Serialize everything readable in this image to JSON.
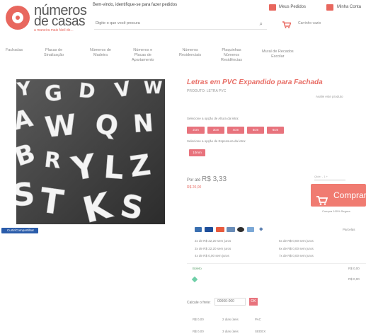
{
  "header": {
    "logo_line1": "números",
    "logo_line2": "de casas",
    "logo_tagline": "a maneira mais fácil de...",
    "welcome": "Bem-vindo, identifique-se para fazer pedidos",
    "search_placeholder": "Digite o que você procura",
    "my_orders": "Meus Pedidos",
    "my_account": "Minha Conta",
    "cart": "Carrinho vazio"
  },
  "nav": {
    "items": [
      {
        "label": "Fachadas"
      },
      {
        "label": "Placas de\nSinalização"
      },
      {
        "label": "Números de\nMadeira"
      },
      {
        "label": "Números e\nPlacas de\nApartamento"
      },
      {
        "label": "Números\nResidenciais"
      },
      {
        "label": "Plaquinhas\nNúmeros\nResidências"
      },
      {
        "label": "Mural de Recados\nEscolar"
      }
    ]
  },
  "badge": "Curtir/Compartilhar",
  "product": {
    "title": "Letras em PVC Expandido para Fachada",
    "ref": "PRODUTO: LETRA PVC",
    "review": "Avalie este produto",
    "option1_label": "Selecione a opção de Altura da letra:",
    "option1_values": [
      "2cm",
      "3cm",
      "4cm",
      "5cm",
      "6cm"
    ],
    "option2_label": "Selecione a opção de Espessura da letra:",
    "option2_values": [
      "10mm"
    ],
    "price_prefix": "Por até",
    "price": "R$ 3,33",
    "price_old": "R$ 20,00",
    "qty_label": "Qtde: - 1 +",
    "buy_label": "Comprar",
    "buy_sub": "Compra 100% Segura",
    "pay_more": "Parcelas",
    "installments_left": [
      "2x de R$ 22,20 sem juros",
      "3x de R$ 22,20 sem juros",
      "4x de R$ 0,00 sem juros"
    ],
    "installments_right": [
      "5x de R$ 0,00 sem juros",
      "6x de R$ 0,00 sem juros",
      "7x de R$ 0,00 sem juros"
    ],
    "discount_left": "Boleto",
    "discount_right": "R$ 0,00",
    "discount2_right": "R$ 0,00",
    "shipping_label": "Calcule o frete:",
    "cep_value": "00000-000",
    "cep_button": "OK",
    "ship_cols": [
      "R$ 0,00",
      "2 dias úteis",
      "PAC",
      "R$ 0,00",
      "3 dias úteis",
      "SEDEX"
    ]
  },
  "colors": {
    "accent": "#e86e66",
    "button": "#f07b71",
    "option": "#e8737d",
    "badge": "#2a5caa"
  }
}
